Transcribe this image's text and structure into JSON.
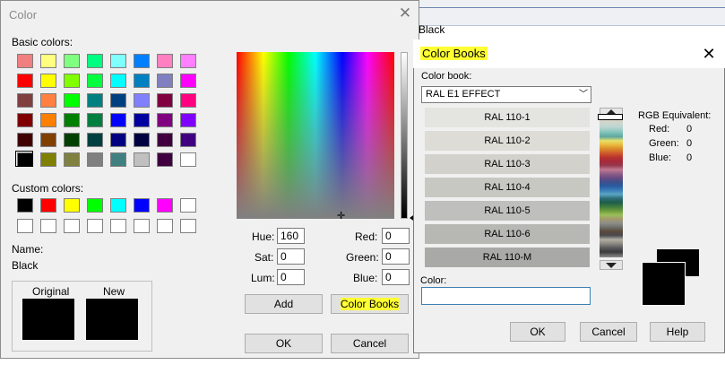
{
  "background": {
    "text": "Black"
  },
  "color_dialog": {
    "title": "Color",
    "basic_colors_label": "Basic colors:",
    "basic_colors": [
      [
        "#f08080",
        "#ffff80",
        "#80ff80",
        "#00ff80",
        "#80ffff",
        "#0080ff",
        "#ff80c0",
        "#ff80ff"
      ],
      [
        "#ff0000",
        "#ffff00",
        "#80ff00",
        "#00ff40",
        "#00ffff",
        "#0080c0",
        "#8080c0",
        "#ff00ff"
      ],
      [
        "#804040",
        "#ff8040",
        "#00ff00",
        "#008080",
        "#004080",
        "#8080ff",
        "#800040",
        "#ff0080"
      ],
      [
        "#800000",
        "#ff8000",
        "#008000",
        "#008040",
        "#0000ff",
        "#0000a0",
        "#800080",
        "#8000ff"
      ],
      [
        "#400000",
        "#804000",
        "#004000",
        "#004040",
        "#000080",
        "#000040",
        "#400040",
        "#400080"
      ],
      [
        "#000000",
        "#808000",
        "#808040",
        "#808080",
        "#408080",
        "#c0c0c0",
        "#400040",
        "#ffffff"
      ]
    ],
    "custom_colors_label": "Custom colors:",
    "custom_colors": [
      [
        "#000000",
        "#ff0000",
        "#ffff00",
        "#00ff00",
        "#00ffff",
        "#0000ff",
        "#ff00ff",
        "#ffffff"
      ],
      [
        "#ffffff",
        "#ffffff",
        "#ffffff",
        "#ffffff",
        "#ffffff",
        "#ffffff",
        "#ffffff",
        "#ffffff"
      ]
    ],
    "name_label": "Name:",
    "name_value": "Black",
    "original_label": "Original",
    "new_label": "New",
    "hue_label": "Hue:",
    "hue_value": "160",
    "sat_label": "Sat:",
    "sat_value": "0",
    "lum_label": "Lum:",
    "lum_value": "0",
    "red_label": "Red:",
    "red_value": "0",
    "green_label": "Green:",
    "green_value": "0",
    "blue_label": "Blue:",
    "blue_value": "0",
    "add_button": "Add",
    "color_books_button": "Color Books",
    "ok_button": "OK",
    "cancel_button": "Cancel"
  },
  "books_dialog": {
    "title": "Color Books",
    "color_book_label": "Color book:",
    "color_book_value": "RAL E1 EFFECT",
    "entries": [
      {
        "label": "RAL 110-1",
        "color": "#e4e4e0"
      },
      {
        "label": "RAL 110-2",
        "color": "#dddcd6"
      },
      {
        "label": "RAL 110-3",
        "color": "#d2d1cb"
      },
      {
        "label": "RAL 110-4",
        "color": "#c8c8c3"
      },
      {
        "label": "RAL 110-5",
        "color": "#bfbfbd"
      },
      {
        "label": "RAL 110-6",
        "color": "#b7b7b4"
      },
      {
        "label": "RAL 110-M",
        "color": "#a9a9a7"
      }
    ],
    "rgb_label": "RGB Equivalent:",
    "red_label": "Red:",
    "red_value": "0",
    "green_label": "Green:",
    "green_value": "0",
    "blue_label": "Blue:",
    "blue_value": "0",
    "color_label": "Color:",
    "color_value": "",
    "ok_button": "OK",
    "cancel_button": "Cancel",
    "help_button": "Help"
  },
  "highlight_color": "#ffff33"
}
